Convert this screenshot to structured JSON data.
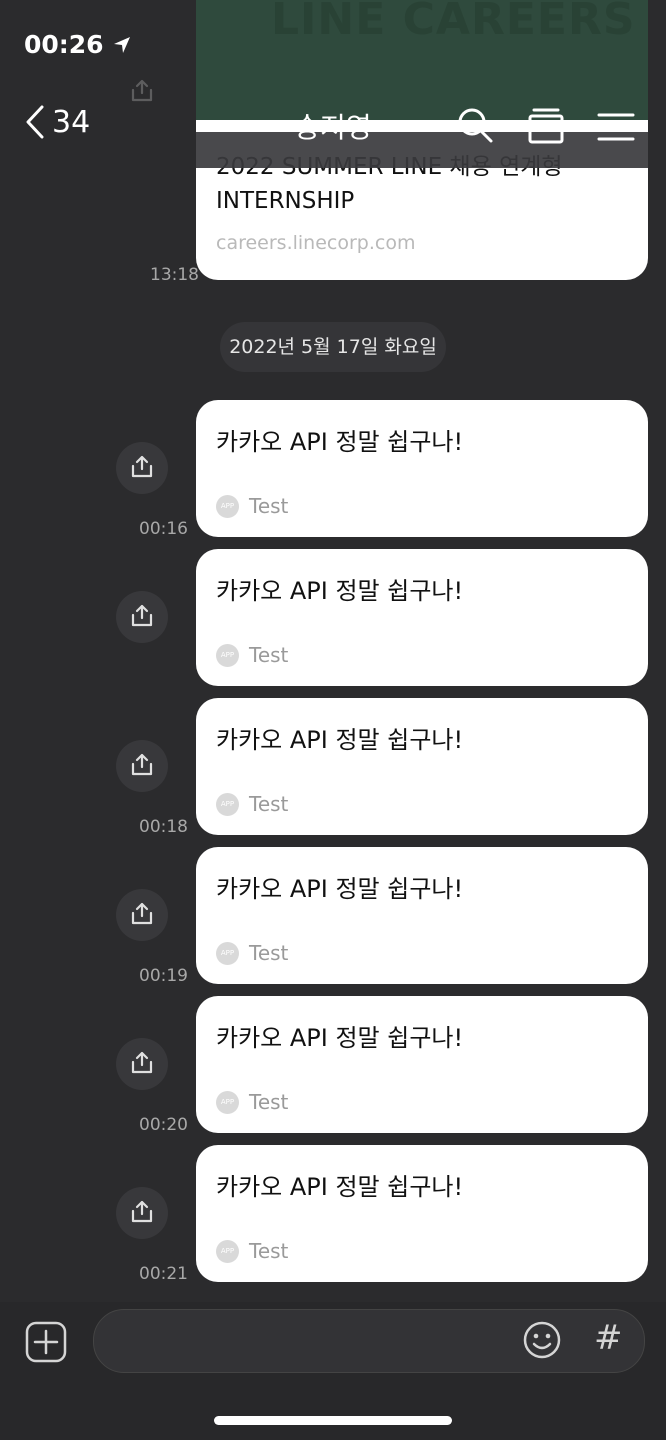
{
  "status_bar": {
    "time": "00:26"
  },
  "header": {
    "back_count": "34",
    "title": "송지영"
  },
  "link_card": {
    "banner_text": "LINE CAREERS",
    "title": "2022 SUMMER LINE 채용 연계형 INTERNSHIP",
    "domain": "careers.linecorp.com",
    "time": "13:18"
  },
  "date_divider": "2022년 5월 17일 화요일",
  "messages": [
    {
      "text": "카카오 API 정말 쉽구나!",
      "app": "Test",
      "time": "00:16"
    },
    {
      "text": "카카오 API 정말 쉽구나!",
      "app": "Test",
      "time": ""
    },
    {
      "text": "카카오 API 정말 쉽구나!",
      "app": "Test",
      "time": "00:18"
    },
    {
      "text": "카카오 API 정말 쉽구나!",
      "app": "Test",
      "time": "00:19"
    },
    {
      "text": "카카오 API 정말 쉽구나!",
      "app": "Test",
      "time": "00:20"
    },
    {
      "text": "카카오 API 정말 쉽구나!",
      "app": "Test",
      "time": "00:21"
    }
  ],
  "app_badge": "APP",
  "input": {
    "hash_label": "#"
  },
  "icons": {
    "location": "location-arrow-icon",
    "signal": "signal-icon",
    "wifi": "wifi-icon",
    "battery": "battery-icon",
    "back": "chevron-left-icon",
    "search": "search-icon",
    "drawer": "drawer-icon",
    "menu": "menu-icon",
    "share": "share-icon",
    "plus": "plus-icon",
    "emoji": "emoji-icon"
  }
}
